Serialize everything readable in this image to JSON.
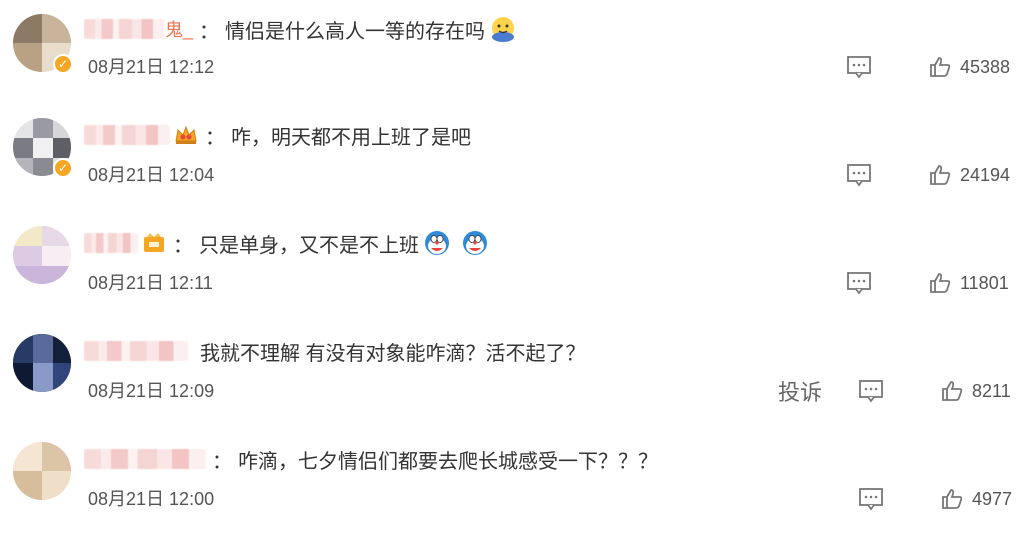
{
  "comments": [
    {
      "name_suffix": "鬼_",
      "colon": "：",
      "text": "情侣是什么高人一等的存在吗",
      "emoji": [
        "facepalm-emoji"
      ],
      "time": "08月21日 12:12",
      "likes": "45388",
      "badge": null,
      "verified": true,
      "report_label": null
    },
    {
      "name_suffix": "",
      "colon": "：",
      "text": "咋，明天都不用上班了是吧",
      "emoji": [],
      "time": "08月21日 12:04",
      "likes": "24194",
      "badge": "crown-badge",
      "verified": true,
      "report_label": null
    },
    {
      "name_suffix": "",
      "colon": "：",
      "text": "只是单身，又不是不上班",
      "emoji": [
        "doraemon-emoji",
        "doraemon-emoji"
      ],
      "time": "08月21日 12:11",
      "likes": "11801",
      "badge": "vip-badge",
      "verified": false,
      "report_label": null
    },
    {
      "name_suffix": "",
      "colon": "",
      "text": "我就不理解 有没有对象能咋滴？活不起了？",
      "emoji": [],
      "time": "08月21日 12:09",
      "likes": "8211",
      "badge": null,
      "verified": false,
      "report_label": "投诉"
    },
    {
      "name_suffix": "",
      "colon": "：",
      "text": "咋滴，七夕情侣们都要去爬长城感受一下？？？",
      "emoji": [],
      "time": "08月21日 12:00",
      "likes": "4977",
      "badge": null,
      "verified": false,
      "report_label": null
    }
  ],
  "colors": {
    "text": "#333333",
    "time": "#555555",
    "name_accent": "#eb7350",
    "verified": "#f5a623",
    "icon": "#777777"
  }
}
